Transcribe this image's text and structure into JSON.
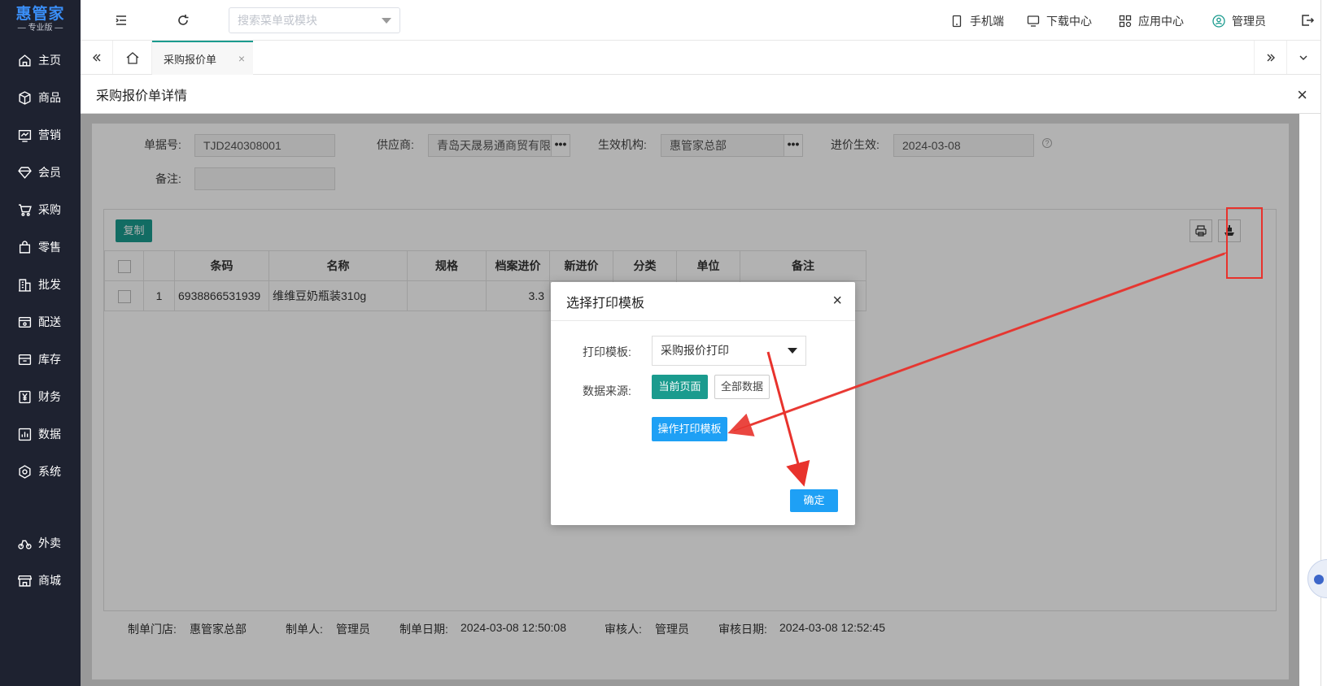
{
  "logo": {
    "main": "惠管家",
    "sub": "专业版"
  },
  "sidebar": {
    "items": [
      {
        "label": "主页",
        "icon": "home-icon"
      },
      {
        "label": "商品",
        "icon": "box-icon"
      },
      {
        "label": "营销",
        "icon": "chart-icon"
      },
      {
        "label": "会员",
        "icon": "diamond-icon"
      },
      {
        "label": "采购",
        "icon": "cart-icon"
      },
      {
        "label": "零售",
        "icon": "bag-icon"
      },
      {
        "label": "批发",
        "icon": "building-icon"
      },
      {
        "label": "配送",
        "icon": "truck-icon"
      },
      {
        "label": "库存",
        "icon": "warehouse-icon"
      },
      {
        "label": "财务",
        "icon": "yen-icon"
      },
      {
        "label": "数据",
        "icon": "data-icon"
      },
      {
        "label": "系统",
        "icon": "settings-icon"
      },
      {
        "label": "外卖",
        "icon": "bike-icon"
      },
      {
        "label": "商城",
        "icon": "shop-icon"
      }
    ]
  },
  "topbar": {
    "search_placeholder": "搜索菜单或模块",
    "links": {
      "mobile": "手机端",
      "download": "下载中心",
      "apps": "应用中心",
      "user": "管理员"
    }
  },
  "tabs": {
    "active": "采购报价单",
    "close": "×"
  },
  "page": {
    "title": "采购报价单详情",
    "close": "×"
  },
  "form": {
    "doc_no_label": "单据号:",
    "doc_no": "TJD240308001",
    "supplier_label": "供应商:",
    "supplier": "青岛天晟易通商贸有限公司",
    "org_label": "生效机构:",
    "org": "惠管家总部",
    "effective_label": "进价生效:",
    "effective": "2024-03-08",
    "remark_label": "备注:",
    "remark": "",
    "dots": "•••",
    "help": "?"
  },
  "toolbar": {
    "copy": "复制"
  },
  "table": {
    "headers": [
      "条码",
      "名称",
      "规格",
      "档案进价",
      "新进价",
      "分类",
      "单位",
      "备注"
    ],
    "rows": [
      {
        "index": "1",
        "barcode": "6938866531939",
        "name": "维维豆奶瓶装310g",
        "spec": "",
        "old_price": "3.3",
        "new_price": "",
        "category": "",
        "unit": "",
        "remark": ""
      }
    ]
  },
  "footer": {
    "store_label": "制单门店:",
    "store": "惠管家总部",
    "maker_label": "制单人:",
    "maker": "管理员",
    "make_date_label": "制单日期:",
    "make_date": "2024-03-08 12:50:08",
    "auditor_label": "审核人:",
    "auditor": "管理员",
    "audit_date_label": "审核日期:",
    "audit_date": "2024-03-08 12:52:45"
  },
  "modal": {
    "title": "选择打印模板",
    "close": "×",
    "template_label": "打印模板:",
    "template_value": "采购报价打印",
    "source_label": "数据来源:",
    "current_page": "当前页面",
    "all_data": "全部数据",
    "operate_template": "操作打印模板",
    "confirm": "确定"
  },
  "colors": {
    "sidebar_bg": "#1e2230",
    "accent_teal": "#1a9b8e",
    "primary_blue": "#1ea0f5",
    "annotation_red": "#e8322c"
  }
}
